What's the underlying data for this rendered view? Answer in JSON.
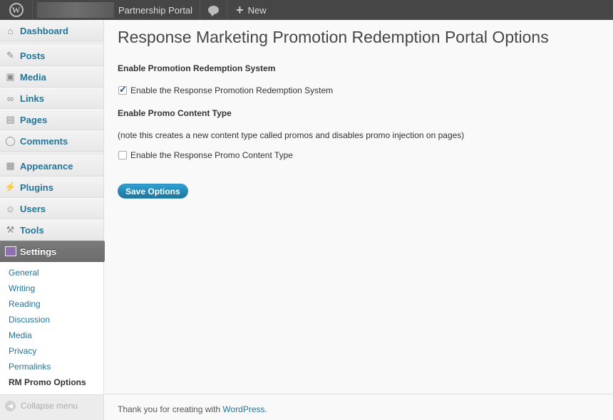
{
  "adminbar": {
    "site_name": "Partnership Portal",
    "new_label": "New"
  },
  "sidebar": {
    "items": [
      {
        "label": "Dashboard",
        "icon": "house-icon"
      },
      {
        "label": "Posts",
        "icon": "pushpin-icon"
      },
      {
        "label": "Media",
        "icon": "media-icon"
      },
      {
        "label": "Links",
        "icon": "link-icon"
      },
      {
        "label": "Pages",
        "icon": "pages-icon"
      },
      {
        "label": "Comments",
        "icon": "comment-icon"
      },
      {
        "label": "Appearance",
        "icon": "appearance-icon"
      },
      {
        "label": "Plugins",
        "icon": "plug-icon"
      },
      {
        "label": "Users",
        "icon": "users-icon"
      },
      {
        "label": "Tools",
        "icon": "tools-icon"
      },
      {
        "label": "Settings",
        "icon": "settings-icon"
      }
    ],
    "settings_submenu": [
      "General",
      "Writing",
      "Reading",
      "Discussion",
      "Media",
      "Privacy",
      "Permalinks",
      "RM Promo Options"
    ],
    "collapse_label": "Collapse menu"
  },
  "main": {
    "title": "Response Marketing Promotion Redemption Portal Options",
    "section1_title": "Enable Promotion Redemption System",
    "checkbox1_label": "Enable the Response Promotion Redemption System",
    "checkbox1_checked": true,
    "section2_title": "Enable Promo Content Type",
    "note": "(note this creates a new content type called promos and disables promo injection on pages)",
    "checkbox2_label": "Enable the Response Promo Content Type",
    "checkbox2_checked": false,
    "save_label": "Save Options"
  },
  "footer": {
    "text": "Thank you for creating with ",
    "link": "WordPress",
    "suffix": "."
  },
  "colors": {
    "link": "#21759b",
    "adminbar": "#464646",
    "button": "#21759b"
  }
}
